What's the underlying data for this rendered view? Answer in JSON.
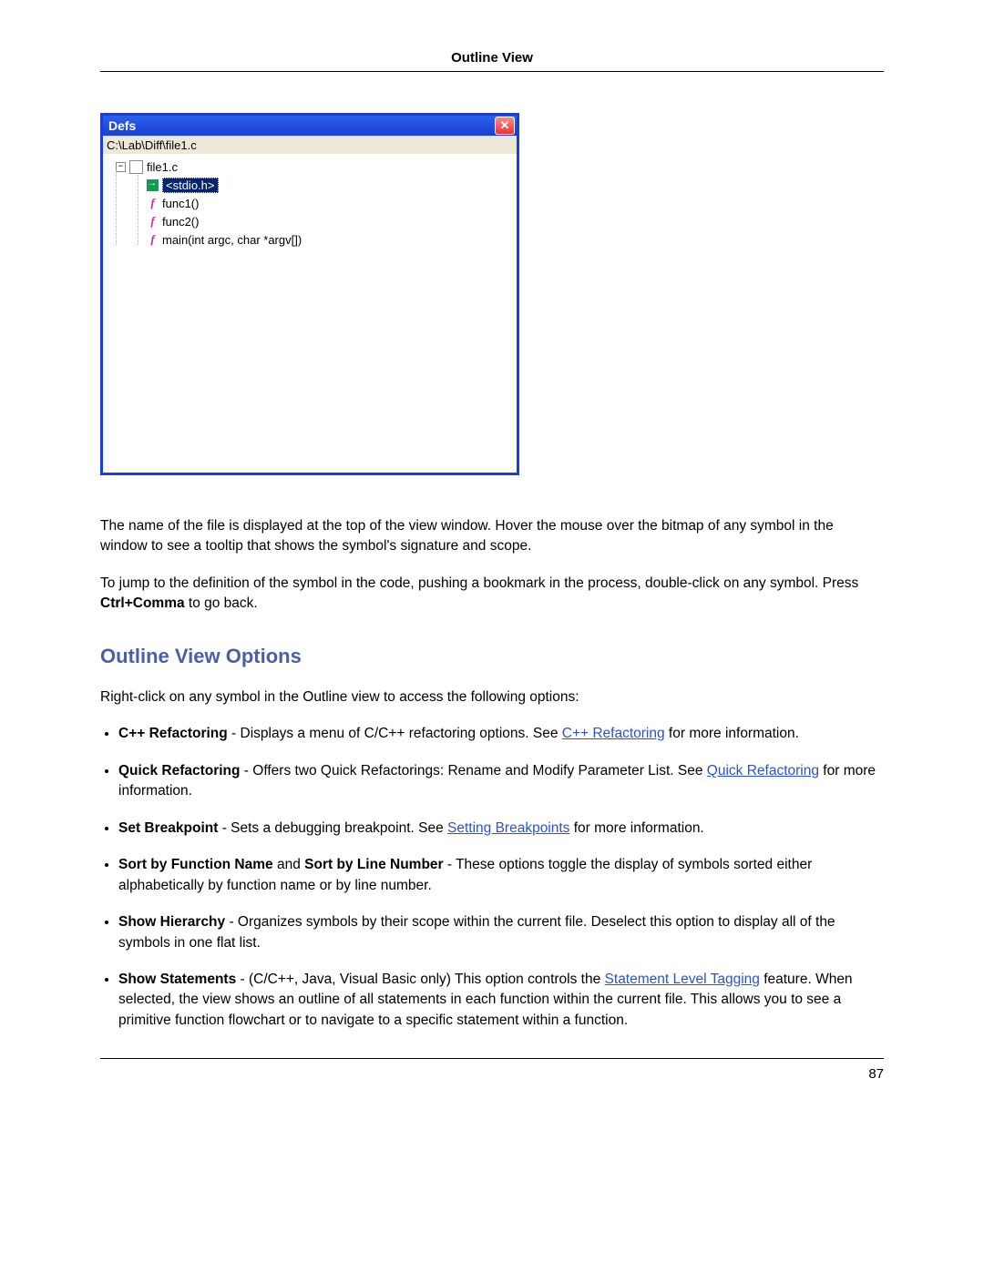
{
  "header": {
    "title": "Outline View"
  },
  "defs_window": {
    "title": "Defs",
    "path": "C:\\Lab\\Diff\\file1.c",
    "tree": {
      "root": "file1.c",
      "children": [
        {
          "type": "include",
          "label": "<stdio.h>",
          "selected": true
        },
        {
          "type": "func",
          "label": "func1()"
        },
        {
          "type": "func",
          "label": "func2()"
        },
        {
          "type": "func",
          "label": "main(int argc, char *argv[])"
        }
      ]
    }
  },
  "para1": "The name of the file is displayed at the top of the view window. Hover the mouse over the bitmap of any symbol in the window to see a tooltip that shows the symbol's signature and scope.",
  "para2_a": "To jump to the definition of the symbol in the code, pushing a bookmark in the process, double-click on any symbol. Press ",
  "para2_bold": "Ctrl+Comma",
  "para2_b": " to go back.",
  "section_heading": "Outline View Options",
  "intro": "Right-click on any symbol in the Outline view to access the following options:",
  "options": [
    {
      "bold": "C++ Refactoring",
      "text_a": " - Displays a menu of C/C++ refactoring options. See ",
      "link": "C++ Refactoring",
      "text_b": " for more information."
    },
    {
      "bold": "Quick Refactoring",
      "text_a": " - Offers two Quick Refactorings: Rename and Modify Parameter List. See ",
      "link": "Quick Refactoring",
      "text_b": " for more information."
    },
    {
      "bold": "Set Breakpoint",
      "text_a": " - Sets a debugging breakpoint. See ",
      "link": "Setting Breakpoints",
      "text_b": " for more information."
    },
    {
      "bold": "Sort by Function Name",
      "mid": " and ",
      "bold2": "Sort by Line Number",
      "text_a": " - These options toggle the display of symbols sorted either alphabetically by function name or by line number."
    },
    {
      "bold": "Show Hierarchy",
      "text_a": " - Organizes symbols by their scope within the current file. Deselect this option to display all of the symbols in one flat list."
    },
    {
      "bold": "Show Statements",
      "text_a": " - (C/C++, Java, Visual Basic only) This option controls the ",
      "link": "Statement Level Tagging",
      "text_b": " feature. When selected, the view shows an outline of all statements in each function within the current file. This allows you to see a primitive function flowchart or to navigate to a specific statement within a function."
    }
  ],
  "page_number": "87"
}
